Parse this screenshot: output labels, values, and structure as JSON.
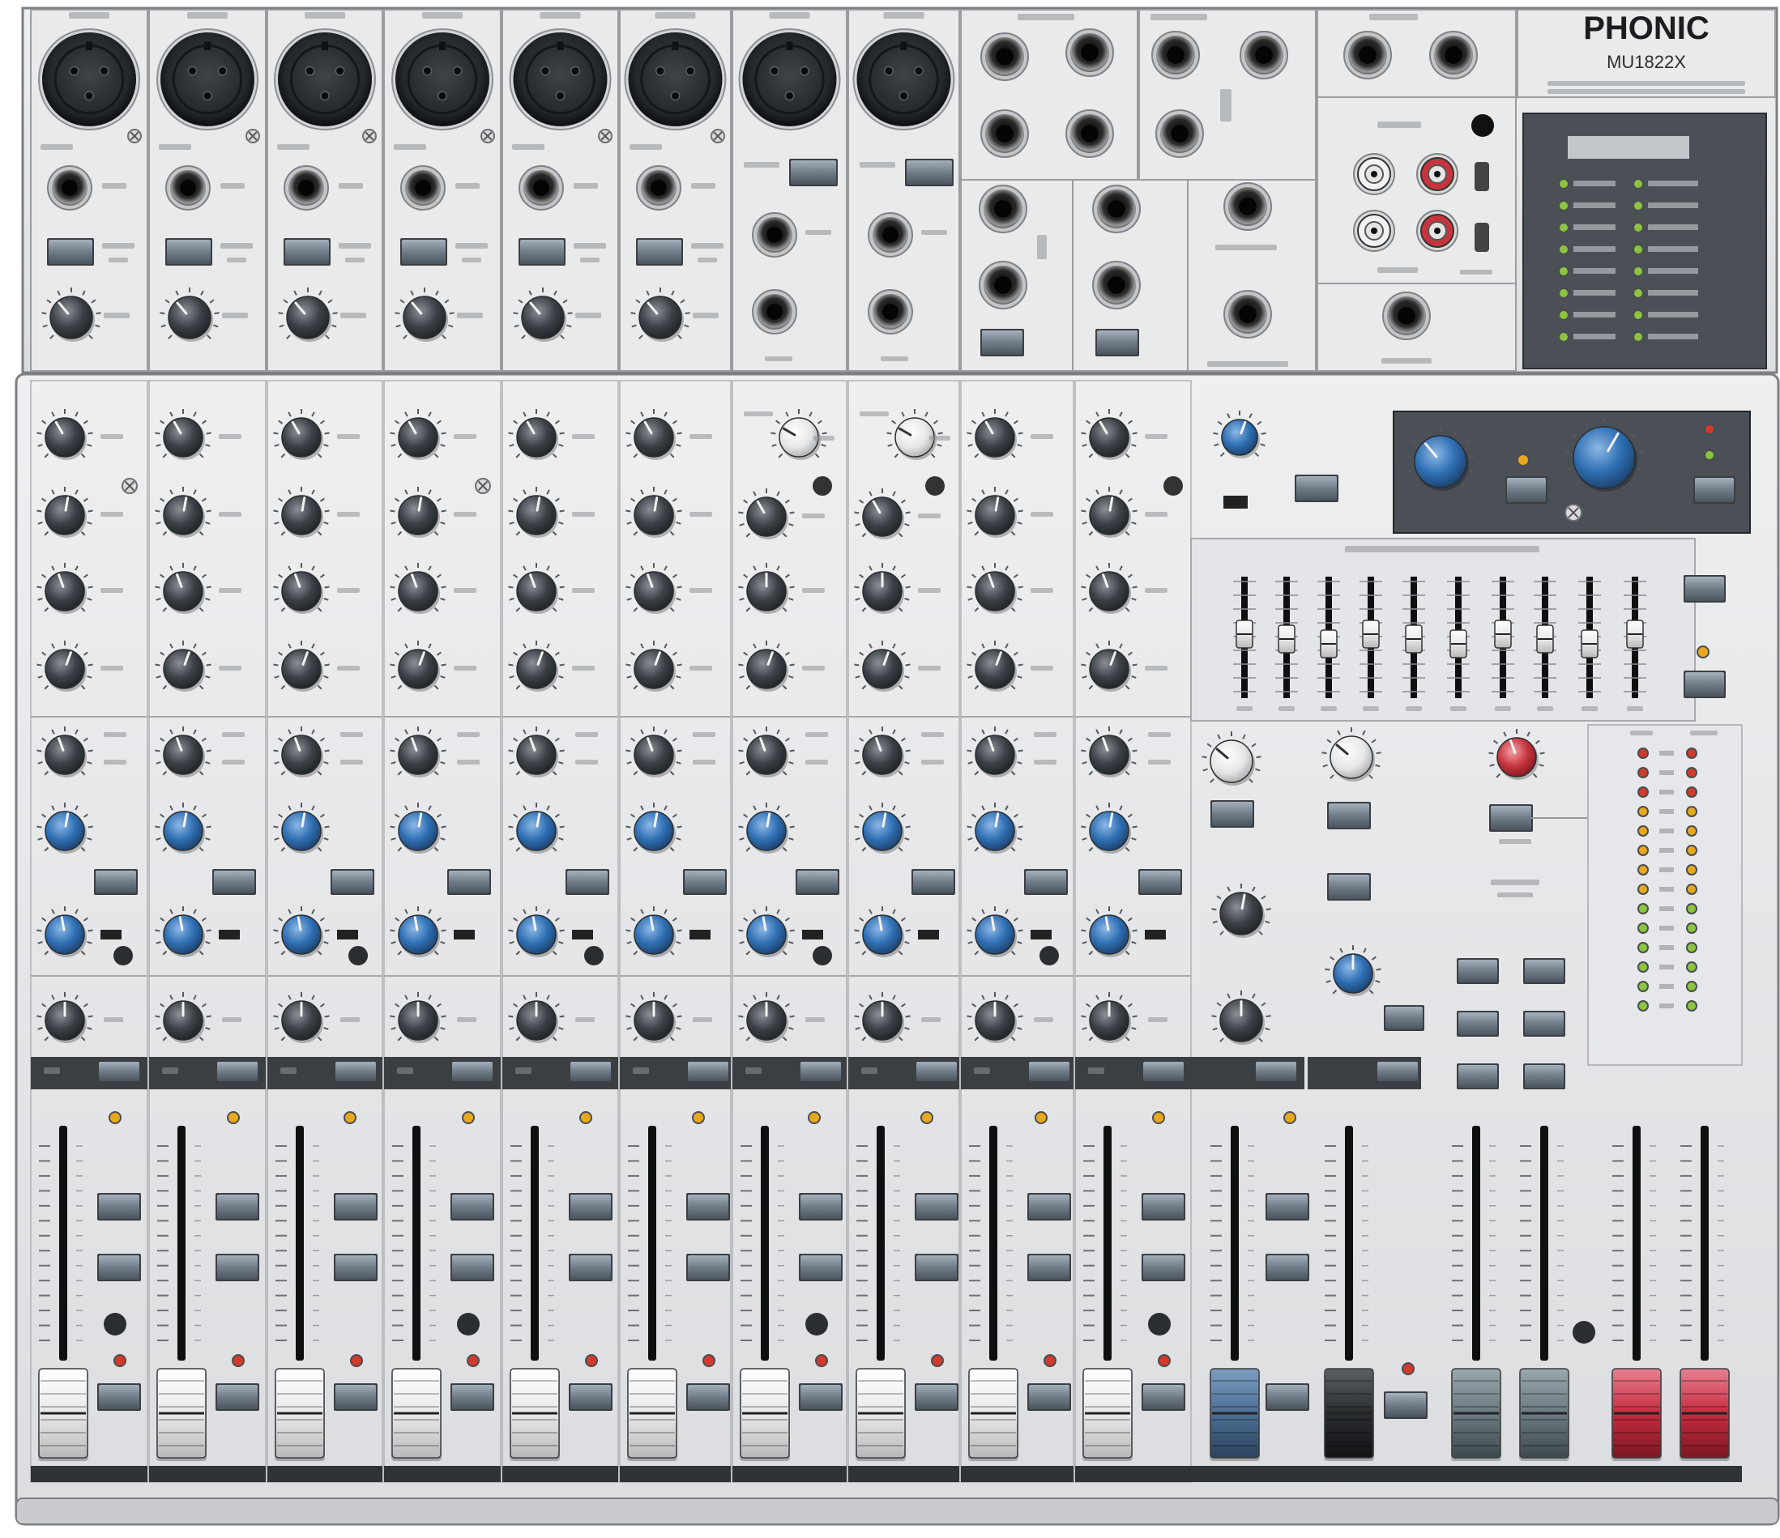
{
  "brand": {
    "logo": "PHONIC",
    "model": "MU1822X"
  },
  "panel_colors": {
    "chassis": "#e7e8ea",
    "chassis_dark": "#c9cbce",
    "divider": "#9a9ca0",
    "strip_bar": "#2e3338",
    "dsp_panel": "#4a5056",
    "knob_dark": "#3b4146",
    "knob_blue": "#2f6fb3",
    "knob_white": "#f4f4f4",
    "knob_red": "#c8343e",
    "button": "#6f7c88",
    "led_green": "#8bc53f",
    "led_red": "#d23a2c",
    "led_amber": "#e8a81e",
    "cap_white": "#f2f2f2",
    "cap_blue": "#4c6f95",
    "cap_black": "#2a2d30",
    "cap_gray": "#6a7a80",
    "cap_red": "#c62c3e"
  },
  "icons": {
    "xlr": "xlr-input-icon",
    "jack": "quarter-inch-jack-icon",
    "rca": "rca-jack-icon",
    "fader": "fader-icon",
    "knob": "rotary-knob-icon"
  }
}
